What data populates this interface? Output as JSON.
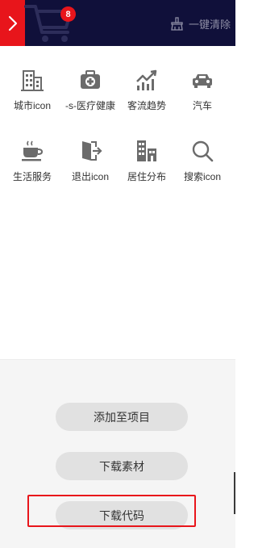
{
  "colors": {
    "topbar_bg": "#10103a",
    "accent_red": "#e8151b",
    "icon_gray": "#6b6b6b",
    "pill_bg": "#e1e1e1",
    "panel_bg": "#f5f5f5"
  },
  "header": {
    "cart_count": "8",
    "clear_label": "一键清除",
    "collapse_icon": "chevron-right-icon",
    "cart_icon": "shopping-cart-icon",
    "clear_icon": "broom-icon"
  },
  "icons": [
    {
      "label": "城市icon",
      "icon": "city-buildings-icon"
    },
    {
      "label": "-s-医疗健康",
      "icon": "medical-kit-icon"
    },
    {
      "label": "客流趋势",
      "icon": "trend-chart-icon"
    },
    {
      "label": "汽车",
      "icon": "car-icon"
    },
    {
      "label": "生活服务",
      "icon": "coffee-cup-icon"
    },
    {
      "label": "退出icon",
      "icon": "logout-door-icon"
    },
    {
      "label": "居住分布",
      "icon": "residence-distribution-icon"
    },
    {
      "label": "搜索icon",
      "icon": "search-icon"
    }
  ],
  "actions": {
    "add_to_project": "添加至项目",
    "download_asset": "下载素材",
    "download_code": "下载代码"
  }
}
